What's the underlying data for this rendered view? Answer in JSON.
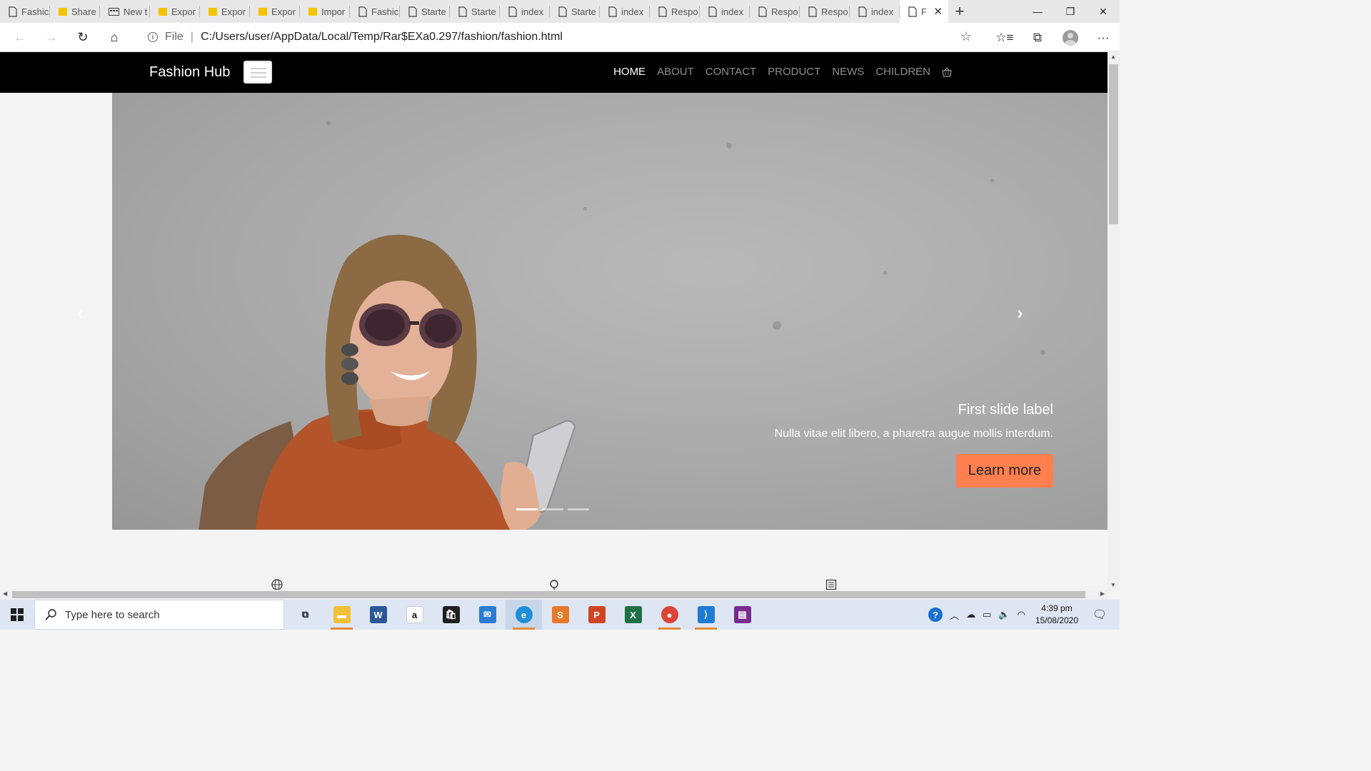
{
  "browser": {
    "tabs": [
      {
        "label": "Fashic",
        "icon": "page-icon"
      },
      {
        "label": "Share",
        "icon": "folder-icon"
      },
      {
        "label": "New t",
        "icon": "newtab-icon"
      },
      {
        "label": "Expor",
        "icon": "folder-icon"
      },
      {
        "label": "Expor",
        "icon": "folder-icon"
      },
      {
        "label": "Expor",
        "icon": "folder-icon"
      },
      {
        "label": "Impor",
        "icon": "folder-icon"
      },
      {
        "label": "Fashic",
        "icon": "page-icon"
      },
      {
        "label": "Starte",
        "icon": "page-icon"
      },
      {
        "label": "Starte",
        "icon": "page-icon"
      },
      {
        "label": "index",
        "icon": "page-icon"
      },
      {
        "label": "Starte",
        "icon": "page-icon"
      },
      {
        "label": "index",
        "icon": "page-icon"
      },
      {
        "label": "Respo",
        "icon": "page-icon"
      },
      {
        "label": "index",
        "icon": "page-icon"
      },
      {
        "label": "Respo",
        "icon": "page-icon"
      },
      {
        "label": "Respo",
        "icon": "page-icon"
      },
      {
        "label": "index",
        "icon": "page-icon"
      }
    ],
    "active_tab": {
      "label": "F",
      "close": "✕"
    },
    "new_tab": "+",
    "window_controls": {
      "minimize": "—",
      "restore": "❐",
      "close": "✕"
    },
    "address": {
      "scheme_label": "File",
      "separator": "|",
      "url": "C:/Users/user/AppData/Local/Temp/Rar$EXa0.297/fashion/fashion.html"
    },
    "toolbar_icons": {
      "back": "←",
      "forward": "→",
      "reload": "↻",
      "home": "⌂",
      "favorite": "☆",
      "favorites_list": "☆≡",
      "collections": "⧉",
      "more": "···"
    }
  },
  "site": {
    "brand": "Fashion Hub",
    "nav": [
      {
        "label": "HOME",
        "active": true
      },
      {
        "label": "ABOUT",
        "active": false
      },
      {
        "label": "CONTACT",
        "active": false
      },
      {
        "label": "PRODUCT",
        "active": false
      },
      {
        "label": "NEWS",
        "active": false
      },
      {
        "label": "CHILDREN",
        "active": false
      }
    ],
    "slide": {
      "title": "First slide label",
      "text": "Nulla vitae elit libero, a pharetra augue mollis interdum.",
      "button": "Learn more",
      "prev": "‹",
      "next": "›",
      "indicator_count": 3,
      "active_indicator": 0
    },
    "feature_icons": [
      "globe-icon",
      "search-icon",
      "list-icon"
    ],
    "colors": {
      "nav_bg": "#000000",
      "accent": "#ff7f50"
    }
  },
  "taskbar": {
    "search_placeholder": "Type here to search",
    "apps": [
      {
        "name": "task-view",
        "glyph": "⧉",
        "color": "#dde6f2",
        "running": false
      },
      {
        "name": "file-explorer",
        "glyph": "▬",
        "color": "#f2c037",
        "running": true
      },
      {
        "name": "word",
        "glyph": "W",
        "color": "#2b5797",
        "running": false
      },
      {
        "name": "amazon",
        "glyph": "a",
        "color": "#ffffff",
        "running": false
      },
      {
        "name": "store",
        "glyph": "🛍",
        "color": "#1f1f1f",
        "running": false
      },
      {
        "name": "mail",
        "glyph": "✉",
        "color": "#2b7cd3",
        "running": false
      },
      {
        "name": "edge",
        "glyph": "e",
        "color": "#1e8fd8",
        "running": true
      },
      {
        "name": "sublime",
        "glyph": "S",
        "color": "#e8792b",
        "running": false
      },
      {
        "name": "powerpoint",
        "glyph": "P",
        "color": "#d04423",
        "running": false
      },
      {
        "name": "excel",
        "glyph": "X",
        "color": "#1e7145",
        "running": false
      },
      {
        "name": "chrome",
        "glyph": "●",
        "color": "#db4437",
        "running": true
      },
      {
        "name": "vscode",
        "glyph": "⟩",
        "color": "#1e7bd4",
        "running": true
      },
      {
        "name": "winrar",
        "glyph": "▤",
        "color": "#7a2b8f",
        "running": false
      }
    ],
    "clock": {
      "time": "4:39 pm",
      "date": "15/08/2020"
    }
  }
}
